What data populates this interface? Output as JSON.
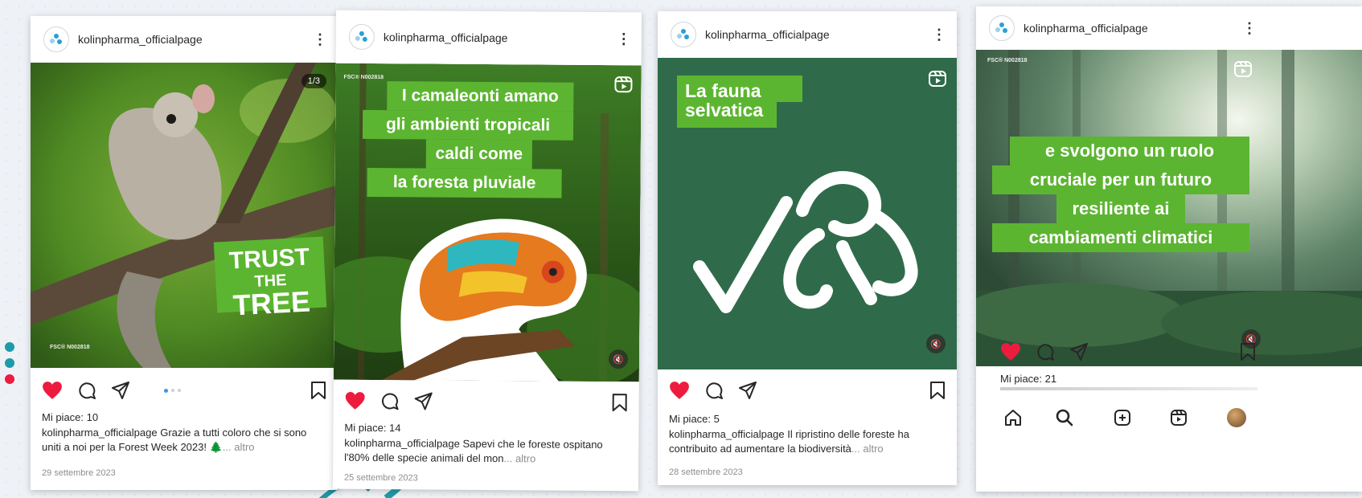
{
  "account": "kolinpharma_officialpage",
  "colors": {
    "brand_green": "#5cb531",
    "dark_green": "#2f6b4a",
    "like_red": "#ed1c3f"
  },
  "posts": [
    {
      "media_type": "carousel",
      "counter": "1/3",
      "overlay": "TRUST THE TREE",
      "overlay_line1": "TRUST",
      "overlay_line2_small": "THE",
      "overlay_line2_big": "TREE",
      "fsc": "FSC® N002818",
      "liked": true,
      "likes": "Mi piace: 10",
      "caption": "Grazie a tutti coloro che si sono uniti a noi per la Forest Week 2023! 🌲",
      "more": "... altro",
      "date": "29 settembre 2023"
    },
    {
      "media_type": "reel",
      "fsc": "FSC® N002818",
      "overlay_lines": [
        "I camaleonti amano",
        "gli ambienti tropicali",
        "caldi come",
        "la foresta pluviale"
      ],
      "liked": true,
      "likes": "Mi piace: 14",
      "caption": "Sapevi che le foreste ospitano l'80% delle specie animali del mon",
      "more": "... altro",
      "date": "25 settembre 2023"
    },
    {
      "media_type": "reel",
      "overlay_lines": [
        "La fauna",
        "selvatica"
      ],
      "liked": true,
      "likes": "Mi piace: 5",
      "caption": "Il ripristino delle foreste ha contribuito ad aumentare la biodiversità",
      "more": "... altro",
      "date": "28 settembre 2023"
    },
    {
      "media_type": "reel",
      "fsc": "FSC® N002818",
      "overlay_lines": [
        "e svolgono un ruolo",
        "cruciale per un futuro",
        "resiliente ai",
        "cambiamenti climatici"
      ],
      "liked": true,
      "likes": "Mi piace: 21"
    }
  ],
  "icons": {
    "like": "heart-icon",
    "comment": "comment-icon",
    "share": "paper-plane-icon",
    "save": "bookmark-icon",
    "reel": "reels-icon",
    "mute": "muted-speaker-icon"
  },
  "bottom_nav": [
    "home-icon",
    "search-icon",
    "create-icon",
    "reels-icon",
    "profile-avatar"
  ]
}
